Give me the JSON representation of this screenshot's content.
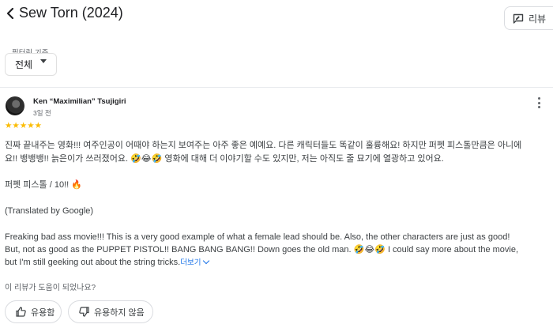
{
  "header": {
    "title": "Sew Torn (2024)",
    "write_review_label": "리뷰 ",
    "back_icon": "chevron-left-icon",
    "review_icon": "rate-review-icon"
  },
  "filter": {
    "label": "필터링 기준",
    "selected": "전체"
  },
  "review": {
    "author": "Ken “Maximilian” Tsujigiri",
    "date": "3일 전",
    "rating": 5,
    "stars_text": "★★★★★",
    "line1": "진짜 끝내주는 영화!!! 여주인공이 어때야 하는지 보여주는 아주 좋은 예예요. 다른 캐릭터들도 똑같이 훌륭해요! 하지만 퍼펫 피스톨만큼은 아니에",
    "line2": "요!! 뱅뱅뱅!! 늙은이가 쓰러졌어요. 🤣😂🤣 영화에 대해 더 이야기할 수도 있지만, 저는 아직도 줄 묘기에 열광하고 있어요.",
    "line3": "퍼펫 피스톨 / 10!! 🔥",
    "translated_note": "(Translated by Google)",
    "line4": "Freaking bad ass movie!!! This is a very good example of what a female lead should be. Also, the other characters are just as good!",
    "line5": "But, not as good as the PUPPET PISTOL!! BANG BANG BANG!! Down goes the old man. 🤣😂🤣 I could say more about the movie,",
    "line6": "but I'm still geeking out about the string tricks.",
    "more_label": "더보기"
  },
  "helpful": {
    "question": "이 리뷰가 도움이 되었나요?",
    "yes_label": "유용함",
    "no_label": "유용하지 않음"
  },
  "colors": {
    "star": "#fbbc04",
    "link": "#1a73e8",
    "text": "#3c4043"
  }
}
